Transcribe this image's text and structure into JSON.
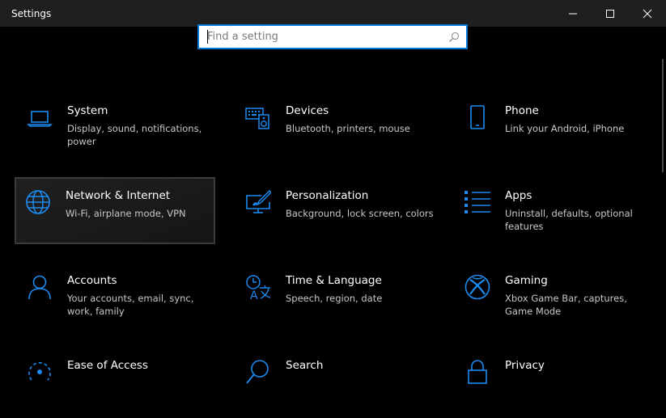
{
  "window": {
    "title": "Settings"
  },
  "search": {
    "placeholder": "Find a setting",
    "icon": "search-icon"
  },
  "categories": [
    {
      "name": "System",
      "desc": "Display, sound, notifications, power",
      "icon": "laptop-icon"
    },
    {
      "name": "Devices",
      "desc": "Bluetooth, printers, mouse",
      "icon": "keyboard-speaker-icon"
    },
    {
      "name": "Phone",
      "desc": "Link your Android, iPhone",
      "icon": "phone-icon"
    },
    {
      "name": "Network & Internet",
      "desc": "Wi-Fi, airplane mode, VPN",
      "icon": "globe-icon",
      "selected": true
    },
    {
      "name": "Personalization",
      "desc": "Background, lock screen, colors",
      "icon": "paint-brush-monitor-icon"
    },
    {
      "name": "Apps",
      "desc": "Uninstall, defaults, optional features",
      "icon": "apps-list-icon"
    },
    {
      "name": "Accounts",
      "desc": "Your accounts, email, sync, work, family",
      "icon": "person-icon"
    },
    {
      "name": "Time & Language",
      "desc": "Speech, region, date",
      "icon": "time-language-icon"
    },
    {
      "name": "Gaming",
      "desc": "Xbox Game Bar, captures, Game Mode",
      "icon": "xbox-icon"
    },
    {
      "name": "Ease of Access",
      "desc": "",
      "icon": "ease-of-access-icon"
    },
    {
      "name": "Search",
      "desc": "",
      "icon": "search-category-icon"
    },
    {
      "name": "Privacy",
      "desc": "",
      "icon": "lock-icon"
    }
  ],
  "colors": {
    "accent": "#0078d7",
    "icon": "#1c8bf0",
    "background": "#000000",
    "titlebar": "#1f1f1f"
  }
}
